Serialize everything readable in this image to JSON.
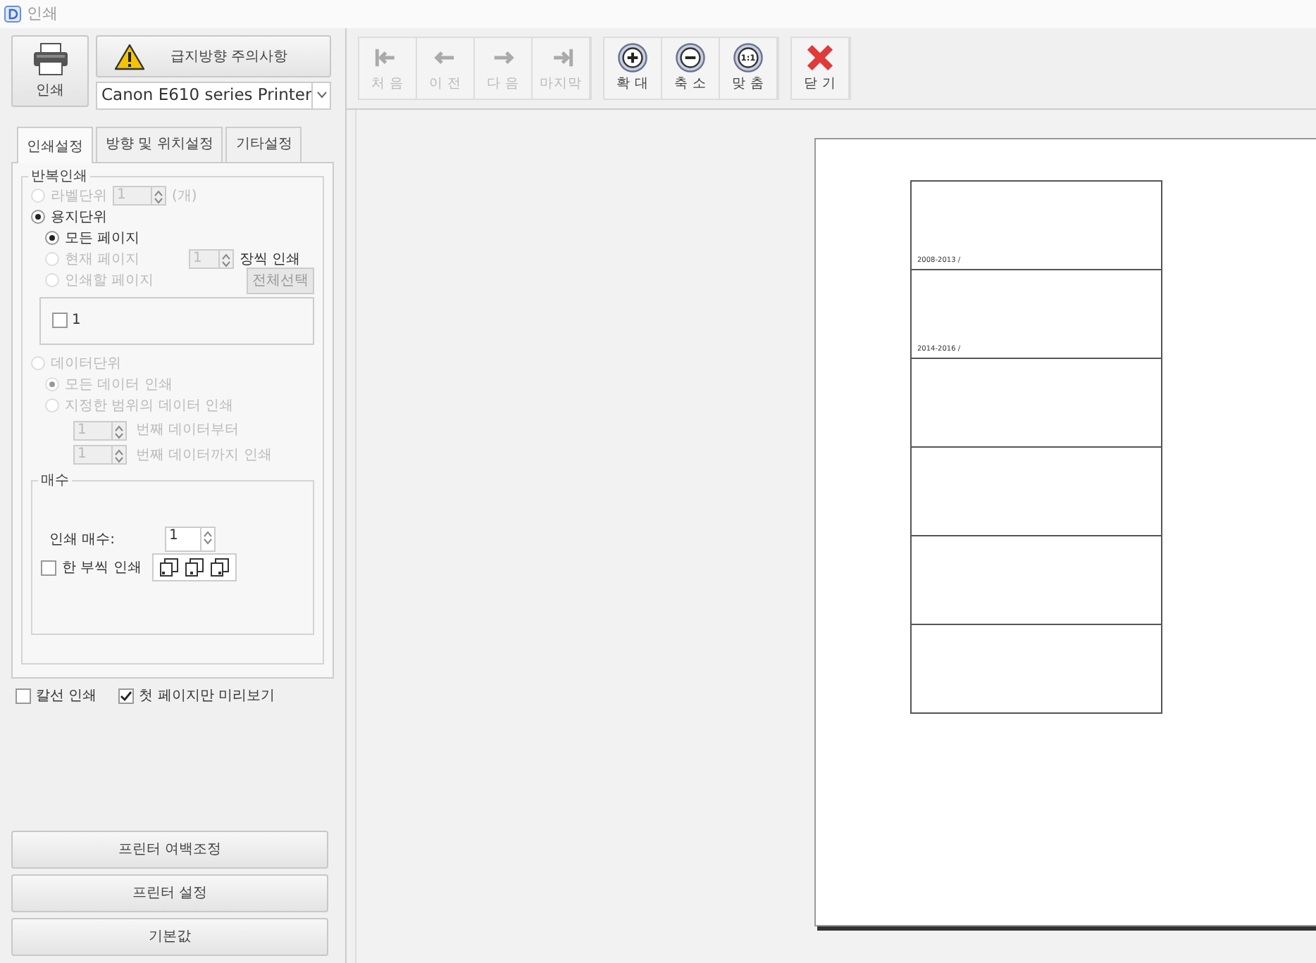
{
  "window": {
    "title": "인쇄"
  },
  "print_button": {
    "label": "인쇄"
  },
  "warning_button": {
    "label": "급지방향 주의사항"
  },
  "printer_select": {
    "value": "Canon E610 series Printer"
  },
  "tabs": [
    {
      "label": "인쇄설정",
      "selected": true
    },
    {
      "label": "방향 및 위치설정",
      "selected": false
    },
    {
      "label": "기타설정",
      "selected": false
    }
  ],
  "repeat_group": {
    "legend": "반복인쇄",
    "modes": [
      {
        "label": "라벨단위",
        "selected": false,
        "disabled": true,
        "spinner": "1",
        "unit": "(개)"
      },
      {
        "label": "용지단위",
        "selected": true,
        "disabled": false,
        "children": [
          {
            "label": "모든 페이지",
            "selected": true,
            "disabled": false
          },
          {
            "label": "현재 페이지",
            "selected": false,
            "disabled": true,
            "spinner": "1",
            "suffix": "장씩 인쇄"
          },
          {
            "label": "인쇄할 페이지",
            "selected": false,
            "disabled": true,
            "button": "전체선택"
          }
        ],
        "pages": [
          {
            "label": "1",
            "checked": false
          }
        ]
      },
      {
        "label": "데이터단위",
        "selected": false,
        "disabled": true,
        "children": [
          {
            "label": "모든 데이터 인쇄",
            "selected": true,
            "disabled": true
          },
          {
            "label": "지정한 범위의 데이터 인쇄",
            "selected": false,
            "disabled": true
          }
        ],
        "ranges": [
          {
            "value": "1",
            "suffix": "번째 데이터부터",
            "disabled": true
          },
          {
            "value": "1",
            "suffix": "번째 데이터까지 인쇄",
            "disabled": true
          }
        ]
      }
    ]
  },
  "copies_group": {
    "legend": "매수",
    "label": "인쇄 매수:",
    "value": "1",
    "collate": {
      "label": "한 부씩 인쇄",
      "checked": false
    }
  },
  "options": [
    {
      "label": "칼선 인쇄",
      "checked": false
    },
    {
      "label": "첫 페이지만 미리보기",
      "checked": true
    }
  ],
  "bottom_buttons": [
    {
      "label": "프린터 여백조정"
    },
    {
      "label": "프린터 설정"
    },
    {
      "label": "기본값"
    }
  ],
  "toolbar": {
    "groups": [
      {
        "buttons": [
          {
            "label": "처 음",
            "kind": "first",
            "disabled": true
          },
          {
            "label": "이 전",
            "kind": "prev",
            "disabled": true
          },
          {
            "label": "다 음",
            "kind": "next",
            "disabled": true
          },
          {
            "label": "마지막",
            "kind": "last",
            "disabled": true
          }
        ]
      },
      {
        "buttons": [
          {
            "label": "확 대",
            "kind": "zoomin",
            "disabled": false
          },
          {
            "label": "축 소",
            "kind": "zoomout",
            "disabled": false
          },
          {
            "label": "맞 춤",
            "kind": "fit",
            "icon_text": "1:1",
            "disabled": false
          }
        ]
      },
      {
        "buttons": [
          {
            "label": "닫 기",
            "kind": "close",
            "disabled": false
          }
        ]
      }
    ]
  },
  "preview": {
    "labels": [
      {
        "kind": "text",
        "text": "2008-2013 /"
      },
      {
        "kind": "text",
        "text": "2014-2016 /"
      },
      {
        "kind": "blank"
      },
      {
        "kind": "blank"
      },
      {
        "kind": "blank"
      },
      {
        "kind": "blank"
      }
    ]
  }
}
